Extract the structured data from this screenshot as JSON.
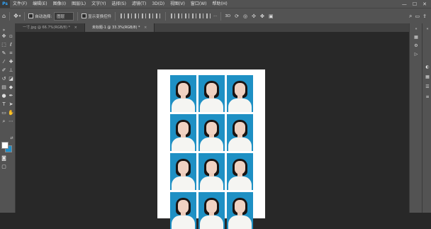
{
  "menubar": {
    "logo": "Ps",
    "items": [
      "文件(F)",
      "编辑(E)",
      "图像(I)",
      "图层(L)",
      "文字(Y)",
      "选择(S)",
      "滤镜(T)",
      "3D(D)",
      "视图(V)",
      "窗口(W)",
      "帮助(H)"
    ],
    "window_controls": [
      "—",
      "☐",
      "✕"
    ]
  },
  "options": {
    "auto_select_label": "自动选择:",
    "auto_select_value": "图层",
    "show_transform_label": "显示变换控件"
  },
  "tabs": [
    {
      "label": "一寸.jpg @ 66.7%(RGB/8) *",
      "close": "×"
    },
    {
      "label": "未标题-1 @ 33.3%(RGB/8) *",
      "close": "×"
    }
  ],
  "colors": {
    "foreground": "#ffffff",
    "background": "#1e8ec8",
    "photo_bg": "#1e90c4"
  },
  "tools": [
    "move-icon",
    "marquee-icon",
    "lasso-icon",
    "quick-select-icon",
    "crop-icon",
    "eyedropper-icon",
    "healing-icon",
    "brush-icon",
    "stamp-icon",
    "history-brush-icon",
    "eraser-icon",
    "gradient-icon",
    "blur-icon",
    "dodge-icon",
    "pen-icon",
    "type-icon",
    "path-select-icon",
    "shape-icon",
    "hand-icon",
    "zoom-icon"
  ]
}
